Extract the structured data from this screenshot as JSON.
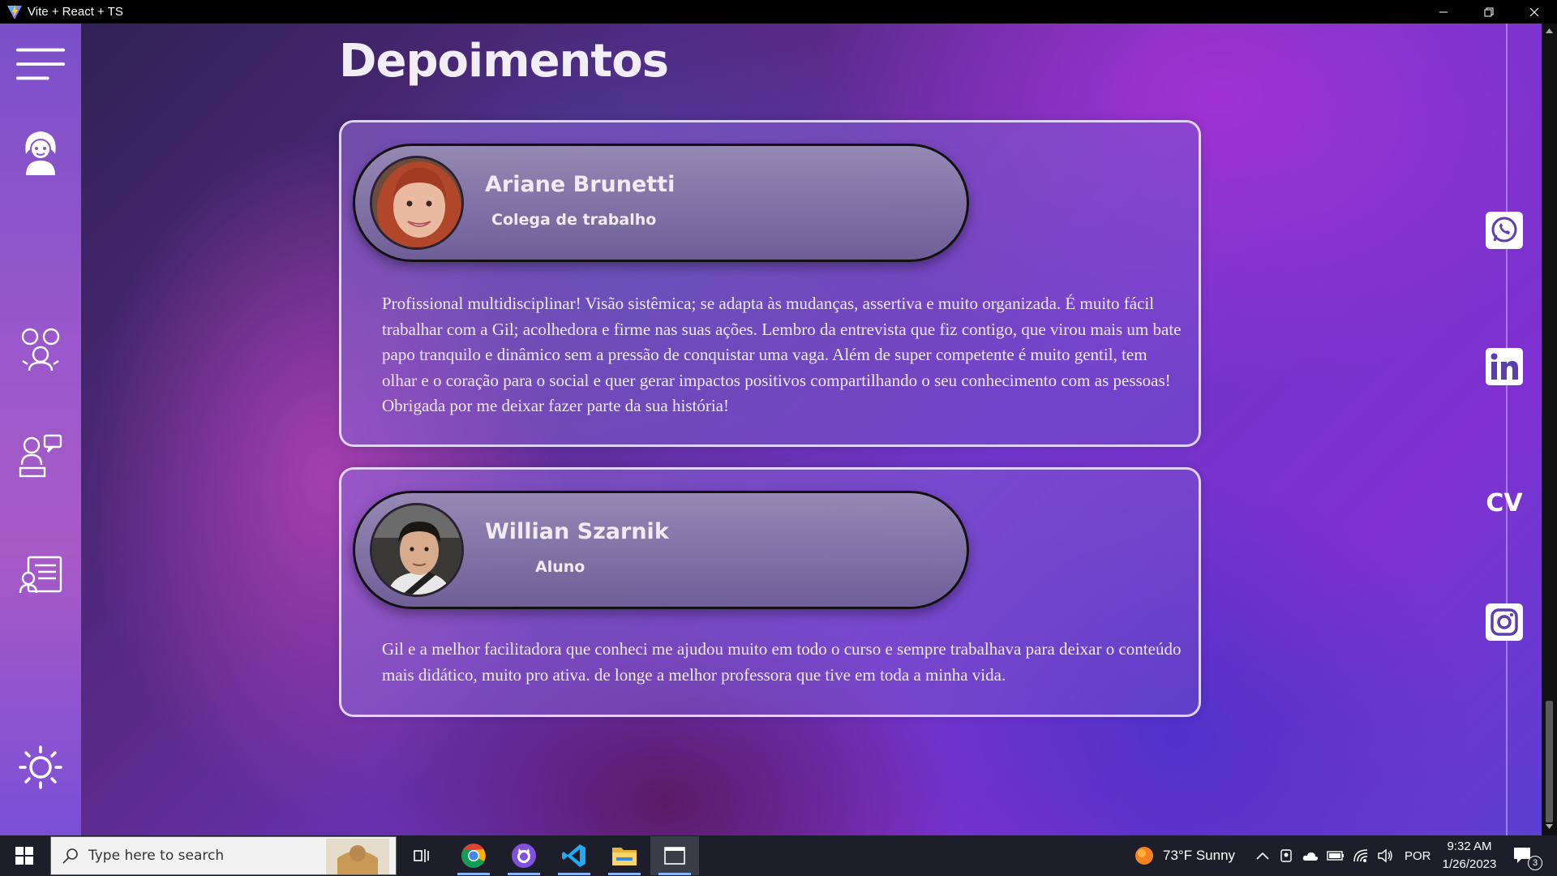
{
  "window": {
    "title": "Vite + React + TS"
  },
  "page": {
    "heading": "Depoimentos"
  },
  "sidebar": {
    "items": [
      {
        "name": "menu-icon"
      },
      {
        "name": "about-me-icon"
      },
      {
        "name": "team-icon"
      },
      {
        "name": "teaching-icon"
      },
      {
        "name": "resume-icon"
      },
      {
        "name": "theme-toggle-sun-icon"
      }
    ]
  },
  "testimonials": [
    {
      "name": "Ariane Brunetti",
      "role": "Colega de trabalho",
      "text": "Profissional multidisciplinar! Visão sistêmica; se adapta às mudanças, assertiva e muito organizada. É muito fácil trabalhar com a Gil; acolhedora e firme nas suas ações. Lembro da entrevista que fiz contigo, que virou mais um bate papo tranquilo e dinâmico sem a pressão de conquistar uma vaga. Além de super competente é muito gentil, tem olhar e o coração para o social e quer gerar impactos positivos compartilhando o seu conhecimento com as pessoas! Obrigada por me deixar fazer parte da sua história!"
    },
    {
      "name": "Willian Szarnik",
      "role": "Aluno",
      "text": "Gil e a melhor facilitadora que conheci me ajudou muito em todo o curso e sempre trabalhava para deixar o conteúdo mais didático, muito pro ativa. de longe a melhor professora que tive em toda a minha vida."
    }
  ],
  "social": {
    "whatsapp": "whatsapp-icon",
    "linkedin": "linkedin-icon",
    "cv_label": "CV",
    "instagram": "instagram-icon"
  },
  "taskbar": {
    "search_placeholder": "Type here to search",
    "weather": "73°F  Sunny",
    "language": "POR",
    "time": "9:32 AM",
    "date": "1/26/2023",
    "notifications": "3"
  }
}
